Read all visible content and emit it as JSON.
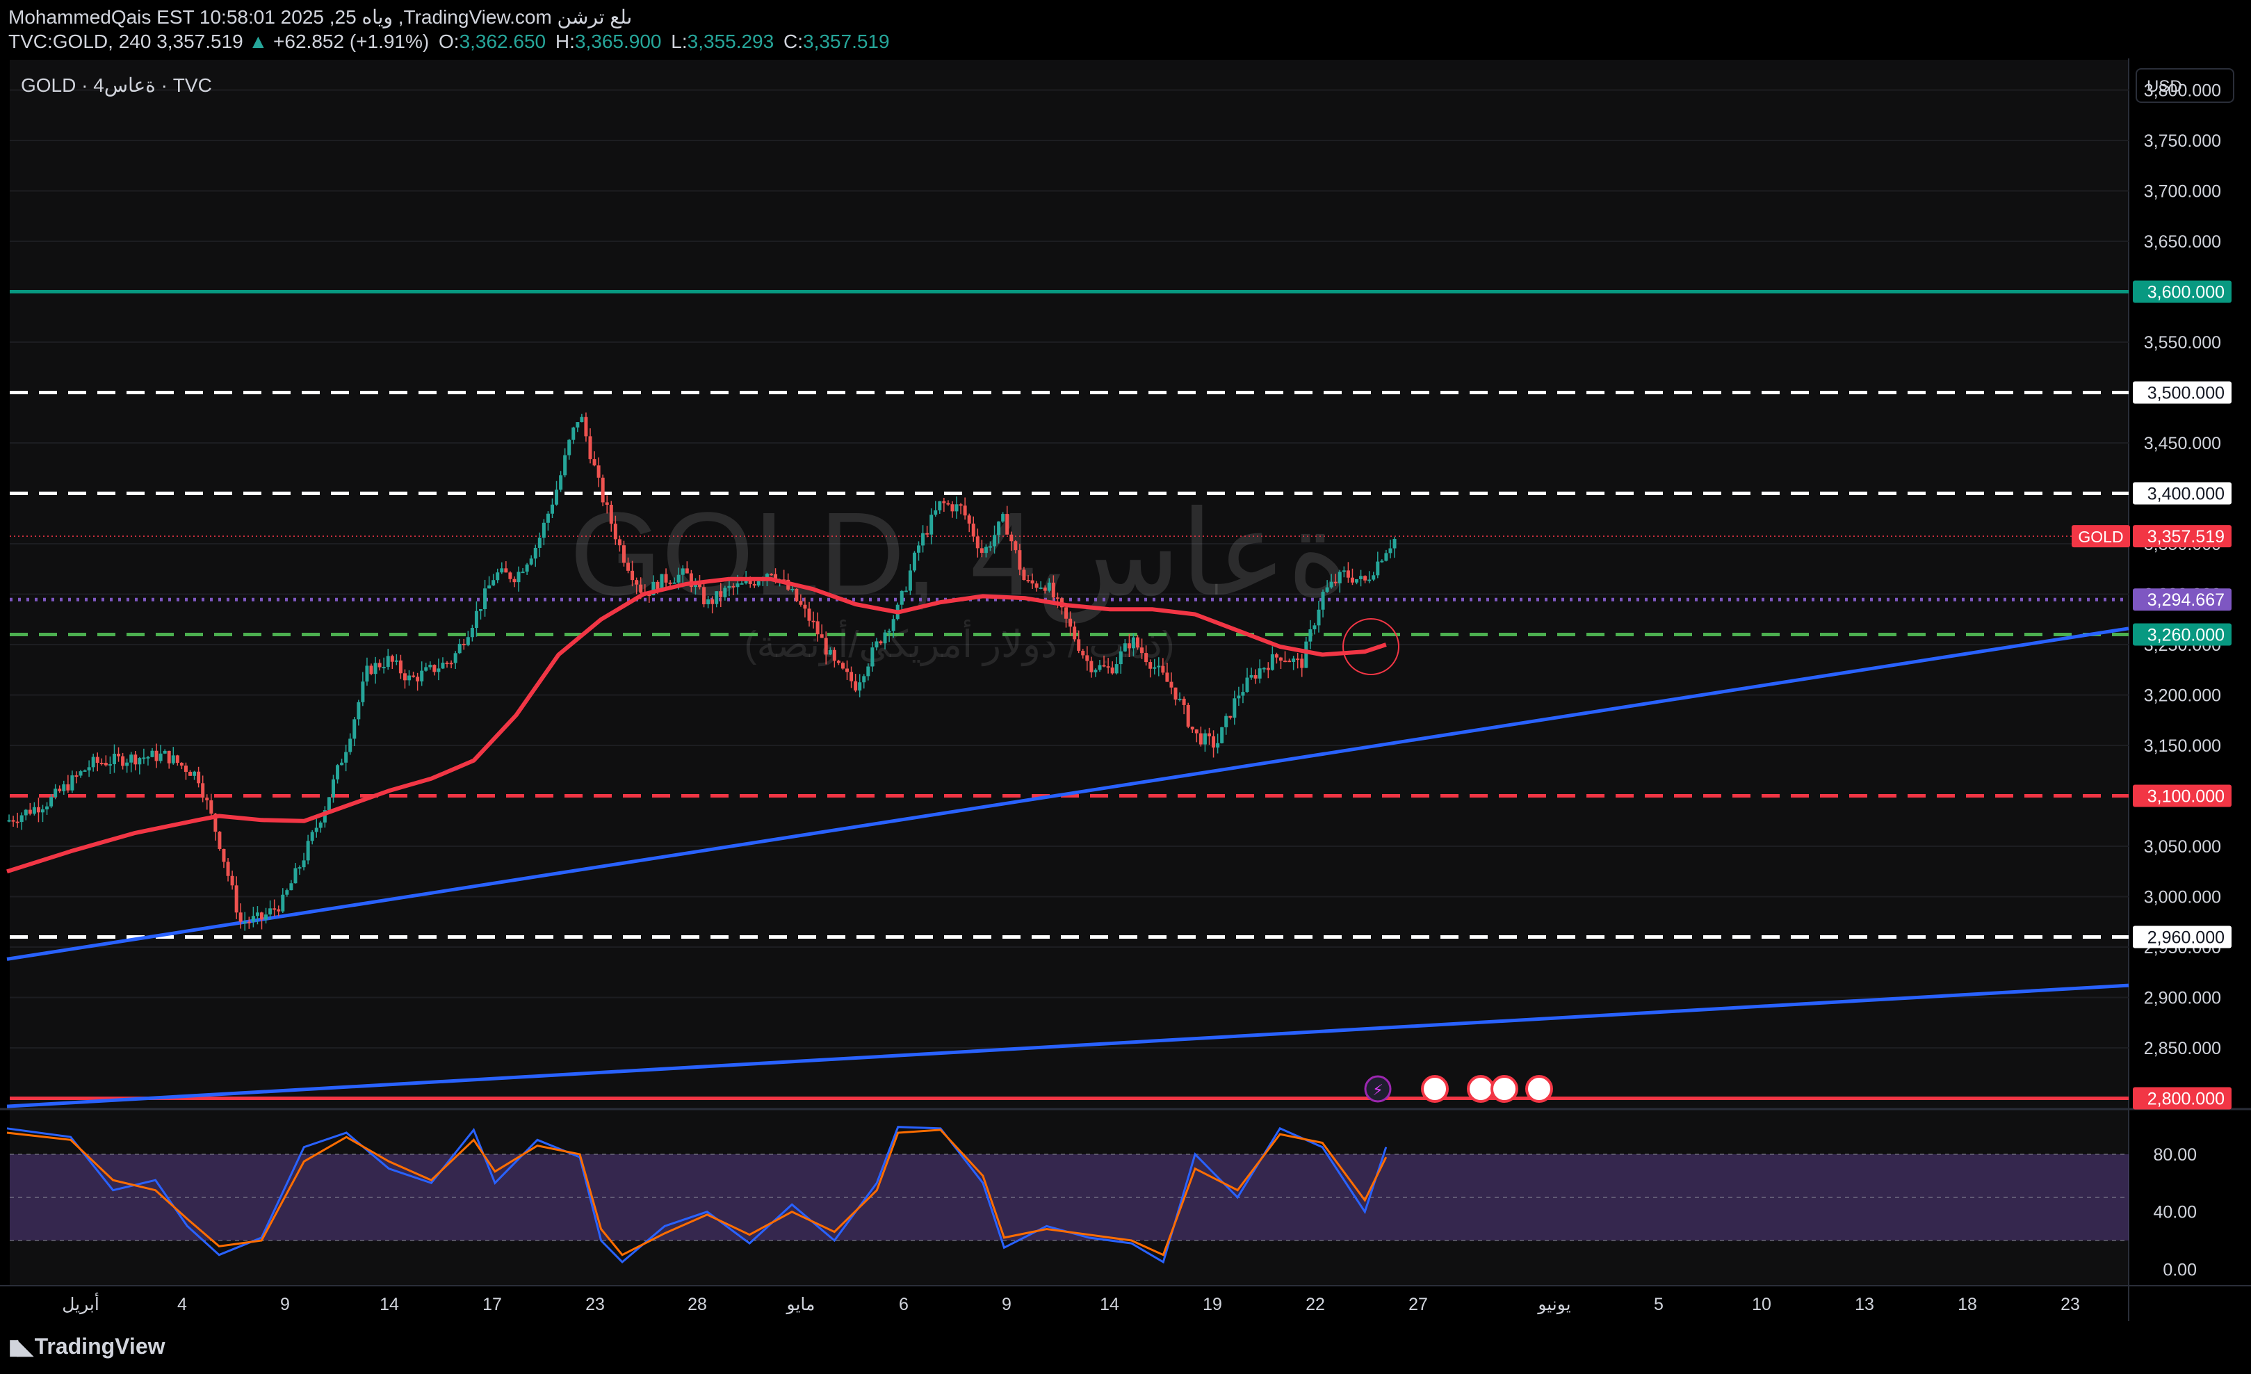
{
  "header": {
    "line1": "MohammedQais EST 10:58:01 2025 ,25 وياه ,TradingView.com ىلع ترشن",
    "symbol": "TVC:GOLD, 240",
    "price": "3,357.519",
    "change_arrow": "▲",
    "change": "+62.852 (+1.91%)",
    "o_label": "O:",
    "o_value": "3,362.650",
    "h_label": "H:",
    "h_value": "3,365.900",
    "l_label": "L:",
    "l_value": "3,355.293",
    "c_label": "C:",
    "c_value": "3,357.519"
  },
  "chart_label": "GOLD · 4ةعاس · TVC",
  "watermark": {
    "main": "GOLD, 4ةعاس",
    "sub": "(ذهب / دولار أمريكي/أونصة)"
  },
  "currency": "USD",
  "brand": "TradingView",
  "colors": {
    "background": "#000000",
    "up": "#26a69a",
    "down": "#ef5350",
    "ma": "#f23645",
    "trendline": "#2962ff",
    "teal_level": "#089981",
    "rsi_band": "#7e57c2",
    "rsi_k": "#2962ff",
    "rsi_d": "#ff6d00"
  },
  "chart_data": {
    "type": "candlestick",
    "symbol": "TVC:GOLD",
    "timeframe": "240",
    "y_ticks": [
      "3,800.000",
      "3,750.000",
      "3,700.000",
      "3,650.000",
      "3,550.000",
      "3,450.000",
      "3,350.000",
      "3,300.000",
      "3,250.000",
      "3,200.000",
      "3,150.000",
      "3,050.000",
      "3,000.000",
      "2,950.000",
      "2,900.000",
      "2,850.000"
    ],
    "y_tick_values": [
      3800,
      3750,
      3700,
      3650,
      3550,
      3450,
      3350,
      3300,
      3250,
      3200,
      3150,
      3050,
      3000,
      2950,
      2900,
      2850
    ],
    "ylim": [
      2790,
      3830
    ],
    "x_ticks": [
      "أبريل",
      "4",
      "9",
      "14",
      "17",
      "23",
      "28",
      "مايو",
      "6",
      "9",
      "14",
      "19",
      "22",
      "27",
      "يونيو",
      "5",
      "10",
      "13",
      "18",
      "23"
    ],
    "horizontal_levels": [
      {
        "value": 3600,
        "label": "3,600.000",
        "style": "solid",
        "color": "#089981"
      },
      {
        "value": 3500,
        "label": "3,500.000",
        "style": "dashed",
        "color": "#ffffff"
      },
      {
        "value": 3400,
        "label": "3,400.000",
        "style": "dashed",
        "color": "#ffffff"
      },
      {
        "value": 3294.667,
        "label": "3,294.667",
        "style": "dotted",
        "color": "#7e57c2"
      },
      {
        "value": 3260,
        "label": "3,260.000",
        "style": "dashed",
        "color": "#4caf50"
      },
      {
        "value": 3100,
        "label": "3,100.000",
        "style": "dashed",
        "color": "#f23645"
      },
      {
        "value": 2960,
        "label": "2,960.000",
        "style": "dashed",
        "color": "#ffffff"
      },
      {
        "value": 2800,
        "label": "2,800.000",
        "style": "solid",
        "color": "#f23645"
      }
    ],
    "last_price": {
      "value": 3357.519,
      "label": "3,357.519",
      "tag": "GOLD"
    },
    "trendlines": [
      {
        "from": [
          0,
          2938
        ],
        "to": [
          1,
          3266
        ],
        "color": "#2962ff"
      },
      {
        "from": [
          0,
          2792
        ],
        "to": [
          1,
          2912
        ],
        "color": "#2962ff"
      }
    ],
    "close_path": [
      [
        0,
        3075
      ],
      [
        0.02,
        3095
      ],
      [
        0.04,
        3132
      ],
      [
        0.06,
        3138
      ],
      [
        0.075,
        3140
      ],
      [
        0.09,
        3120
      ],
      [
        0.1,
        3055
      ],
      [
        0.11,
        2975
      ],
      [
        0.12,
        2978
      ],
      [
        0.13,
        2995
      ],
      [
        0.14,
        3040
      ],
      [
        0.15,
        3090
      ],
      [
        0.16,
        3150
      ],
      [
        0.17,
        3225
      ],
      [
        0.18,
        3235
      ],
      [
        0.19,
        3215
      ],
      [
        0.2,
        3225
      ],
      [
        0.21,
        3235
      ],
      [
        0.22,
        3275
      ],
      [
        0.23,
        3320
      ],
      [
        0.24,
        3318
      ],
      [
        0.25,
        3350
      ],
      [
        0.26,
        3410
      ],
      [
        0.265,
        3450
      ],
      [
        0.27,
        3480
      ],
      [
        0.275,
        3440
      ],
      [
        0.28,
        3400
      ],
      [
        0.29,
        3340
      ],
      [
        0.3,
        3300
      ],
      [
        0.31,
        3315
      ],
      [
        0.32,
        3320
      ],
      [
        0.33,
        3290
      ],
      [
        0.34,
        3305
      ],
      [
        0.35,
        3310
      ],
      [
        0.36,
        3325
      ],
      [
        0.37,
        3300
      ],
      [
        0.38,
        3270
      ],
      [
        0.39,
        3230
      ],
      [
        0.4,
        3210
      ],
      [
        0.41,
        3250
      ],
      [
        0.42,
        3285
      ],
      [
        0.43,
        3350
      ],
      [
        0.44,
        3390
      ],
      [
        0.45,
        3385
      ],
      [
        0.46,
        3340
      ],
      [
        0.47,
        3375
      ],
      [
        0.48,
        3310
      ],
      [
        0.49,
        3310
      ],
      [
        0.5,
        3270
      ],
      [
        0.51,
        3230
      ],
      [
        0.52,
        3225
      ],
      [
        0.53,
        3255
      ],
      [
        0.54,
        3230
      ],
      [
        0.55,
        3205
      ],
      [
        0.56,
        3160
      ],
      [
        0.57,
        3150
      ],
      [
        0.58,
        3200
      ],
      [
        0.59,
        3225
      ],
      [
        0.6,
        3240
      ],
      [
        0.61,
        3230
      ],
      [
        0.62,
        3300
      ],
      [
        0.63,
        3320
      ],
      [
        0.64,
        3312
      ],
      [
        0.65,
        3345
      ],
      [
        0.655,
        3357
      ]
    ],
    "moving_average": [
      [
        0,
        3025
      ],
      [
        0.03,
        3045
      ],
      [
        0.06,
        3063
      ],
      [
        0.09,
        3076
      ],
      [
        0.1,
        3080
      ],
      [
        0.12,
        3076
      ],
      [
        0.14,
        3075
      ],
      [
        0.16,
        3090
      ],
      [
        0.18,
        3105
      ],
      [
        0.2,
        3117
      ],
      [
        0.22,
        3135
      ],
      [
        0.24,
        3180
      ],
      [
        0.26,
        3240
      ],
      [
        0.28,
        3275
      ],
      [
        0.3,
        3300
      ],
      [
        0.32,
        3310
      ],
      [
        0.34,
        3315
      ],
      [
        0.36,
        3315
      ],
      [
        0.38,
        3305
      ],
      [
        0.4,
        3290
      ],
      [
        0.42,
        3282
      ],
      [
        0.44,
        3292
      ],
      [
        0.46,
        3298
      ],
      [
        0.48,
        3296
      ],
      [
        0.5,
        3289
      ],
      [
        0.52,
        3285
      ],
      [
        0.54,
        3285
      ],
      [
        0.56,
        3280
      ],
      [
        0.58,
        3264
      ],
      [
        0.6,
        3248
      ],
      [
        0.62,
        3240
      ],
      [
        0.64,
        3243
      ],
      [
        0.65,
        3250
      ]
    ],
    "rsi_panel": {
      "y_ticks": [
        "80.00",
        "40.00",
        "0.00"
      ],
      "y_tick_values": [
        80,
        40,
        0
      ],
      "ylim": [
        -10,
        110
      ],
      "band": [
        20,
        80
      ],
      "k_path": [
        [
          0,
          98
        ],
        [
          0.03,
          92
        ],
        [
          0.05,
          55
        ],
        [
          0.07,
          62
        ],
        [
          0.085,
          30
        ],
        [
          0.1,
          10
        ],
        [
          0.12,
          22
        ],
        [
          0.14,
          85
        ],
        [
          0.16,
          95
        ],
        [
          0.18,
          70
        ],
        [
          0.2,
          60
        ],
        [
          0.22,
          97
        ],
        [
          0.23,
          60
        ],
        [
          0.25,
          90
        ],
        [
          0.27,
          78
        ],
        [
          0.28,
          20
        ],
        [
          0.29,
          5
        ],
        [
          0.31,
          30
        ],
        [
          0.33,
          40
        ],
        [
          0.35,
          18
        ],
        [
          0.37,
          45
        ],
        [
          0.39,
          20
        ],
        [
          0.41,
          60
        ],
        [
          0.42,
          99
        ],
        [
          0.44,
          98
        ],
        [
          0.46,
          60
        ],
        [
          0.47,
          15
        ],
        [
          0.49,
          30
        ],
        [
          0.51,
          22
        ],
        [
          0.53,
          18
        ],
        [
          0.545,
          5
        ],
        [
          0.56,
          80
        ],
        [
          0.58,
          50
        ],
        [
          0.6,
          98
        ],
        [
          0.62,
          85
        ],
        [
          0.64,
          40
        ],
        [
          0.65,
          85
        ]
      ],
      "d_path": [
        [
          0,
          95
        ],
        [
          0.03,
          90
        ],
        [
          0.05,
          62
        ],
        [
          0.07,
          55
        ],
        [
          0.085,
          35
        ],
        [
          0.1,
          16
        ],
        [
          0.12,
          20
        ],
        [
          0.14,
          75
        ],
        [
          0.16,
          92
        ],
        [
          0.18,
          75
        ],
        [
          0.2,
          62
        ],
        [
          0.22,
          90
        ],
        [
          0.23,
          68
        ],
        [
          0.25,
          86
        ],
        [
          0.27,
          80
        ],
        [
          0.28,
          28
        ],
        [
          0.29,
          10
        ],
        [
          0.31,
          25
        ],
        [
          0.33,
          38
        ],
        [
          0.35,
          24
        ],
        [
          0.37,
          40
        ],
        [
          0.39,
          26
        ],
        [
          0.41,
          55
        ],
        [
          0.42,
          95
        ],
        [
          0.44,
          97
        ],
        [
          0.46,
          65
        ],
        [
          0.47,
          22
        ],
        [
          0.49,
          28
        ],
        [
          0.51,
          24
        ],
        [
          0.53,
          20
        ],
        [
          0.545,
          10
        ],
        [
          0.56,
          70
        ],
        [
          0.58,
          55
        ],
        [
          0.6,
          94
        ],
        [
          0.62,
          88
        ],
        [
          0.64,
          48
        ],
        [
          0.65,
          78
        ]
      ]
    }
  }
}
